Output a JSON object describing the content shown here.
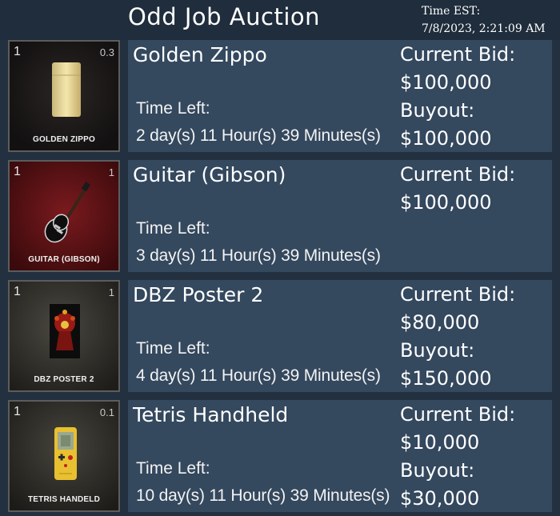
{
  "header": {
    "title": "Odd Job Auction",
    "clock_label": "Time EST:",
    "clock_value": "7/8/2023, 2:21:09 AM"
  },
  "listings": [
    {
      "thumb_label": "GOLDEN ZIPPO",
      "quantity": "1",
      "weight": "0.3",
      "name": "Golden Zippo",
      "time_left_label": "Time Left:",
      "time_left": "2 day(s) 11 Hour(s) 39 Minutes(s)",
      "current_bid_label": "Current Bid:",
      "current_bid": "$100,000",
      "buyout_label": "Buyout:",
      "buyout": "$100,000",
      "icon": "zippo-lighter-icon"
    },
    {
      "thumb_label": "GUITAR (GIBSON)",
      "quantity": "1",
      "weight": "1",
      "name": "Guitar (Gibson)",
      "time_left_label": "Time Left:",
      "time_left": "3 day(s) 11 Hour(s) 39 Minutes(s)",
      "current_bid_label": "Current Bid:",
      "current_bid": "$100,000",
      "icon": "electric-guitar-icon"
    },
    {
      "thumb_label": "DBZ POSTER 2",
      "quantity": "1",
      "weight": "1",
      "name": "DBZ Poster 2",
      "time_left_label": "Time Left:",
      "time_left": "4 day(s) 11 Hour(s) 39 Minutes(s)",
      "current_bid_label": "Current Bid:",
      "current_bid": "$80,000",
      "buyout_label": "Buyout:",
      "buyout": "$150,000",
      "icon": "poster-icon"
    },
    {
      "thumb_label": "TETRIS HANDELD",
      "quantity": "1",
      "weight": "0.1",
      "name": "Tetris Handheld",
      "time_left_label": "Time Left:",
      "time_left": "10 day(s) 11 Hour(s) 39 Minutes(s)",
      "current_bid_label": "Current Bid:",
      "current_bid": "$10,000",
      "buyout_label": "Buyout:",
      "buyout": "$30,000",
      "icon": "handheld-console-icon"
    }
  ],
  "colors": {
    "background": "#22303f",
    "panel": "#34485e",
    "text": "#ffffff"
  }
}
